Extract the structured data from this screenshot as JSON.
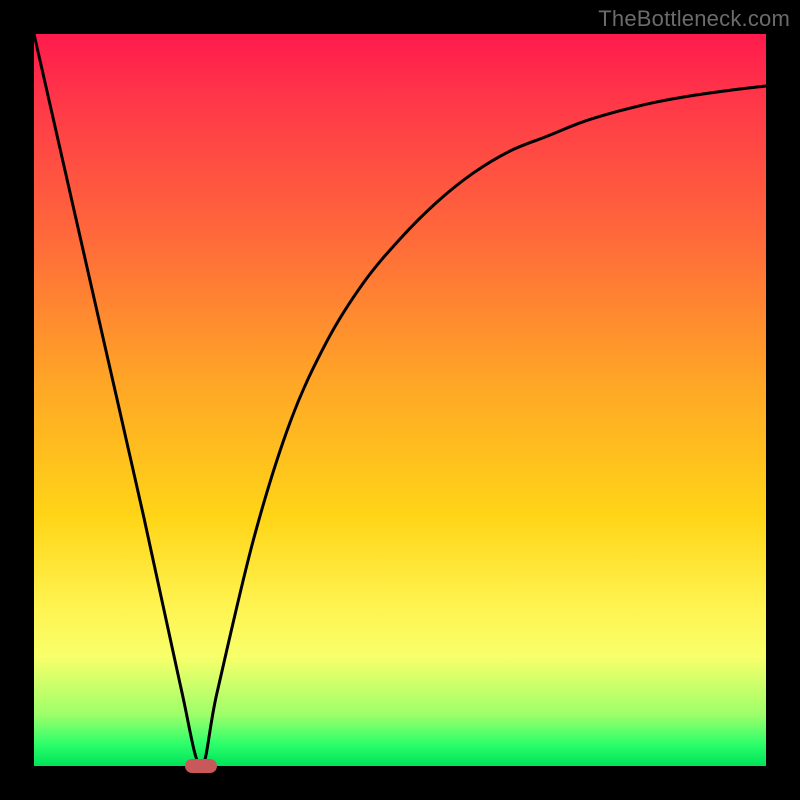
{
  "watermark": "TheBottleneck.com",
  "chart_data": {
    "type": "line",
    "title": "",
    "subtitle": "",
    "xlabel": "",
    "ylabel": "",
    "xlim": [
      0,
      100
    ],
    "ylim": [
      0,
      100
    ],
    "grid": false,
    "legend": false,
    "series": [
      {
        "name": "bottleneck-curve",
        "color": "#000000",
        "x": [
          0,
          5,
          10,
          15,
          20,
          22.8,
          25,
          30,
          35,
          40,
          45,
          50,
          55,
          60,
          65,
          70,
          75,
          80,
          85,
          90,
          95,
          100
        ],
        "values": [
          100,
          78,
          56,
          34,
          11,
          0,
          10,
          31,
          47,
          58,
          66,
          72,
          77,
          81,
          84,
          86,
          88,
          89.5,
          90.7,
          91.6,
          92.3,
          92.9
        ]
      }
    ],
    "marker": {
      "name": "optimal-point",
      "x": 22.8,
      "y": 0,
      "shape": "pill",
      "color": "#c9585a"
    },
    "background_gradient": {
      "direction": "top-to-bottom",
      "stops": [
        {
          "pos": 0,
          "color": "#ff1a4d"
        },
        {
          "pos": 50,
          "color": "#ffc020"
        },
        {
          "pos": 80,
          "color": "#fff350"
        },
        {
          "pos": 100,
          "color": "#00e25a"
        }
      ]
    }
  }
}
